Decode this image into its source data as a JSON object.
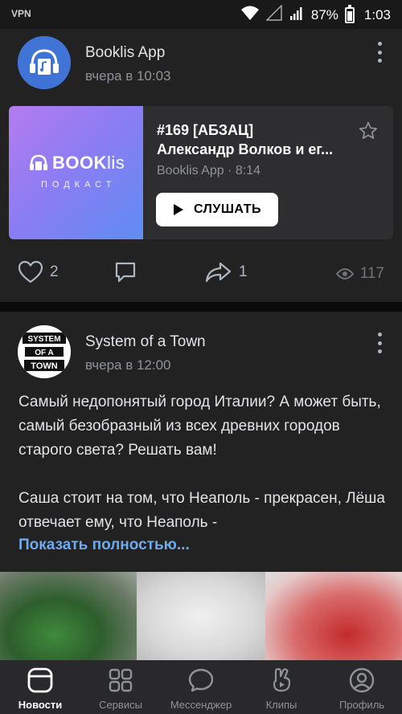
{
  "status_bar": {
    "vpn": "VPN",
    "battery_percent": "87%",
    "battery_level": 0.87,
    "time": "1:03"
  },
  "post1": {
    "author": "Booklis App",
    "date": "вчера в 10:03",
    "podcast": {
      "cover_title_bold": "BOOK",
      "cover_title_light": "lis",
      "cover_subtitle": "ПОДКАСТ",
      "title": "#169 [АБЗАЦ]",
      "artist": "Александр Волков и ег...",
      "meta": "Booklis App · 8:14",
      "listen_label": "СЛУШАТЬ"
    },
    "likes": "2",
    "shares": "1",
    "views": "117"
  },
  "post2": {
    "author": "System of a Town",
    "date": "вчера в 12:00",
    "avatar_text": [
      "SYSTEM",
      "OF A",
      "TOWN"
    ],
    "paragraph1": "Самый недопонятый город Италии? А может быть, самый безобразный из всех древних городов старого света? Решать вам!",
    "paragraph2": "Саша стоит на том, что Неаполь - прекрасен, Лёша отвечает ему, что Неаполь -",
    "show_more": "Показать полностью..."
  },
  "nav": [
    {
      "label": "Новости",
      "icon": "news-icon",
      "active": true
    },
    {
      "label": "Сервисы",
      "icon": "services-icon",
      "active": false
    },
    {
      "label": "Мессенджер",
      "icon": "messenger-icon",
      "active": false
    },
    {
      "label": "Клипы",
      "icon": "clips-icon",
      "active": false
    },
    {
      "label": "Профиль",
      "icon": "profile-icon",
      "active": false
    }
  ],
  "colors": {
    "background": "#19191a",
    "card": "#222223",
    "accent_link": "#71aaeb",
    "secondary_text": "#8f9399"
  }
}
